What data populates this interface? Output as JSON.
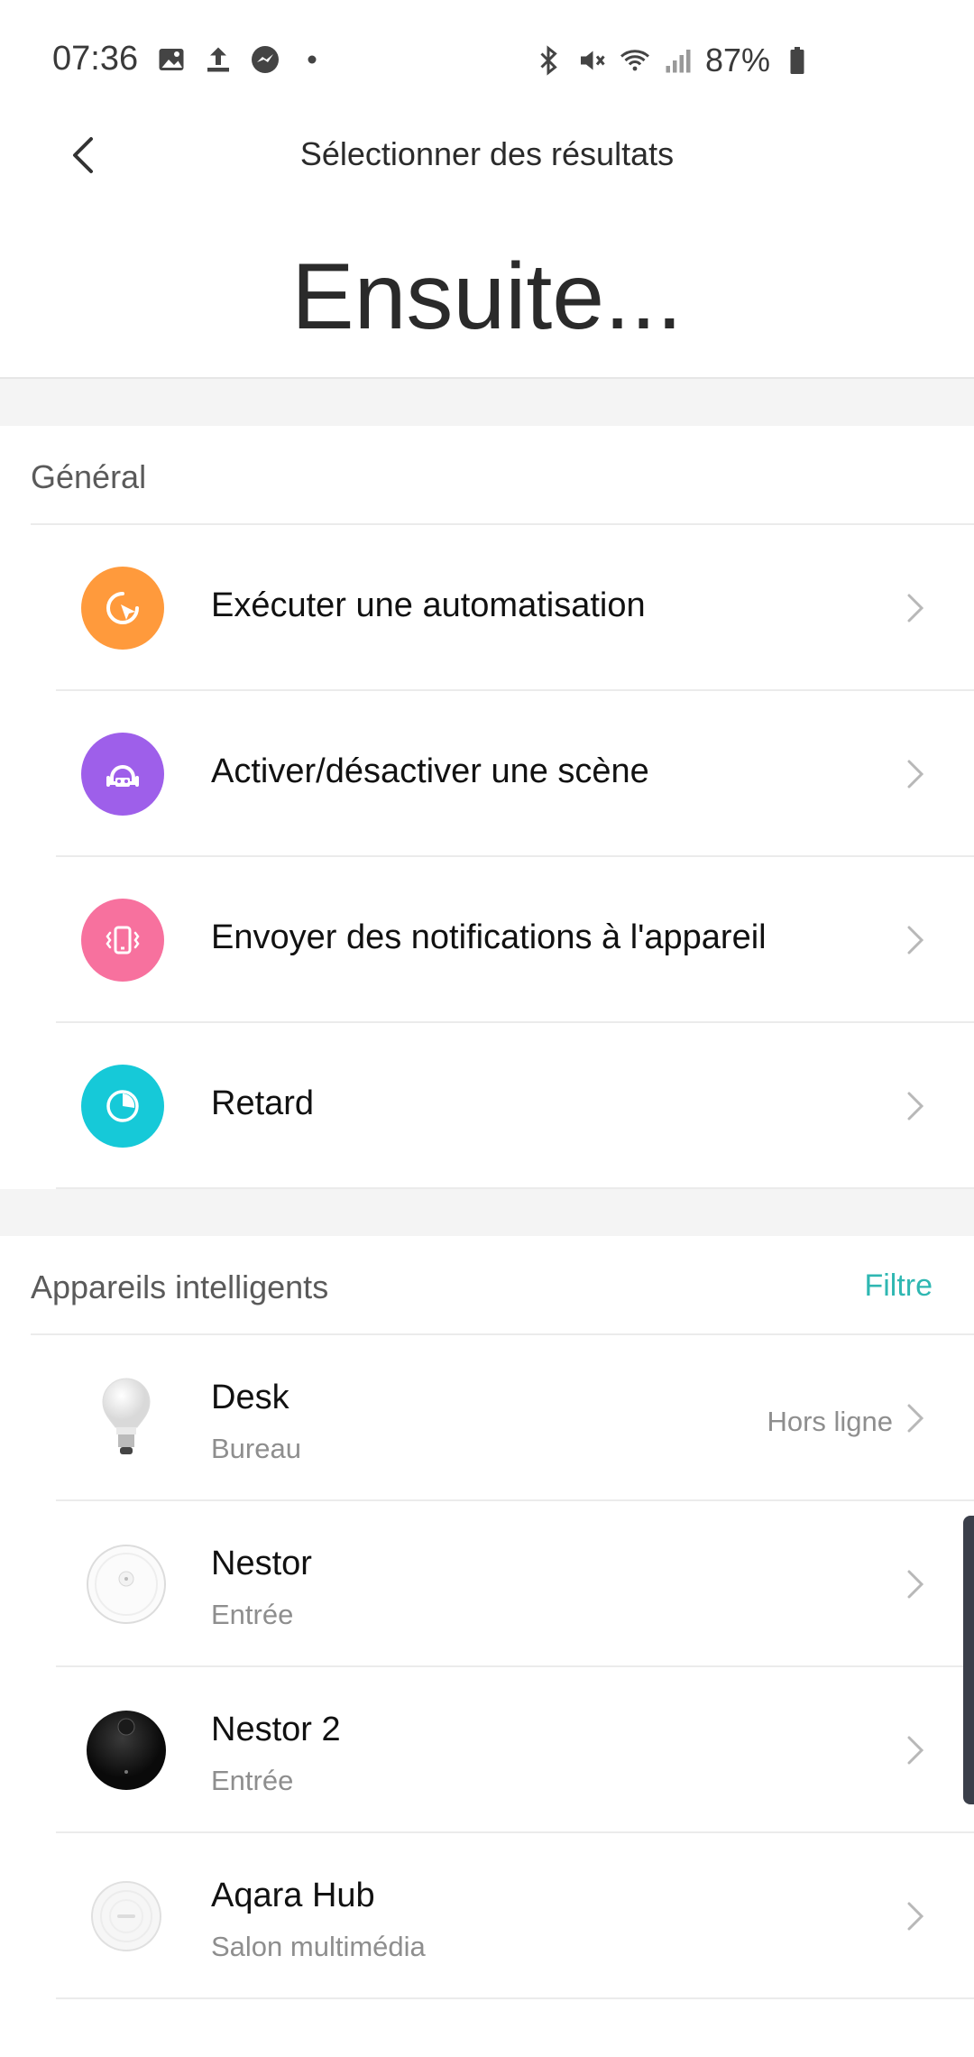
{
  "status_bar": {
    "time": "07:36",
    "battery": "87%",
    "left_icons": [
      "image-icon",
      "upload-icon",
      "messenger-icon",
      "dot-icon"
    ],
    "right_icons": [
      "bluetooth-icon",
      "mute-icon",
      "wifi-icon",
      "signal-icon",
      "battery-icon"
    ]
  },
  "header": {
    "title": "Sélectionner des résultats",
    "back_icon": "back-arrow-icon"
  },
  "page": {
    "big_title": "Ensuite..."
  },
  "general": {
    "title": "Général",
    "items": [
      {
        "label": "Exécuter une automatisation",
        "icon": "automation-cursor-icon",
        "color": "#FF9A3C"
      },
      {
        "label": "Activer/désactiver une scène",
        "icon": "scene-robot-icon",
        "color": "#9E5FEA"
      },
      {
        "label": "Envoyer des notifications à l'appareil",
        "icon": "phone-vibrate-icon",
        "color": "#F7719E"
      },
      {
        "label": "Retard",
        "icon": "timer-icon",
        "color": "#16C9D8"
      }
    ]
  },
  "devices": {
    "title": "Appareils intelligents",
    "filter_label": "Filtre",
    "items": [
      {
        "name": "Desk",
        "room": "Bureau",
        "status": "Hors ligne",
        "icon": "lightbulb-icon"
      },
      {
        "name": "Nestor",
        "room": "Entrée",
        "status": "",
        "icon": "white-robot-vacuum-icon"
      },
      {
        "name": "Nestor 2",
        "room": "Entrée",
        "status": "",
        "icon": "black-robot-vacuum-icon"
      },
      {
        "name": "Aqara Hub",
        "room": "Salon multimédia",
        "status": "",
        "icon": "hub-icon"
      }
    ]
  },
  "colors": {
    "accent": "#2FB7B2",
    "section_gap": "#F4F4F4"
  }
}
